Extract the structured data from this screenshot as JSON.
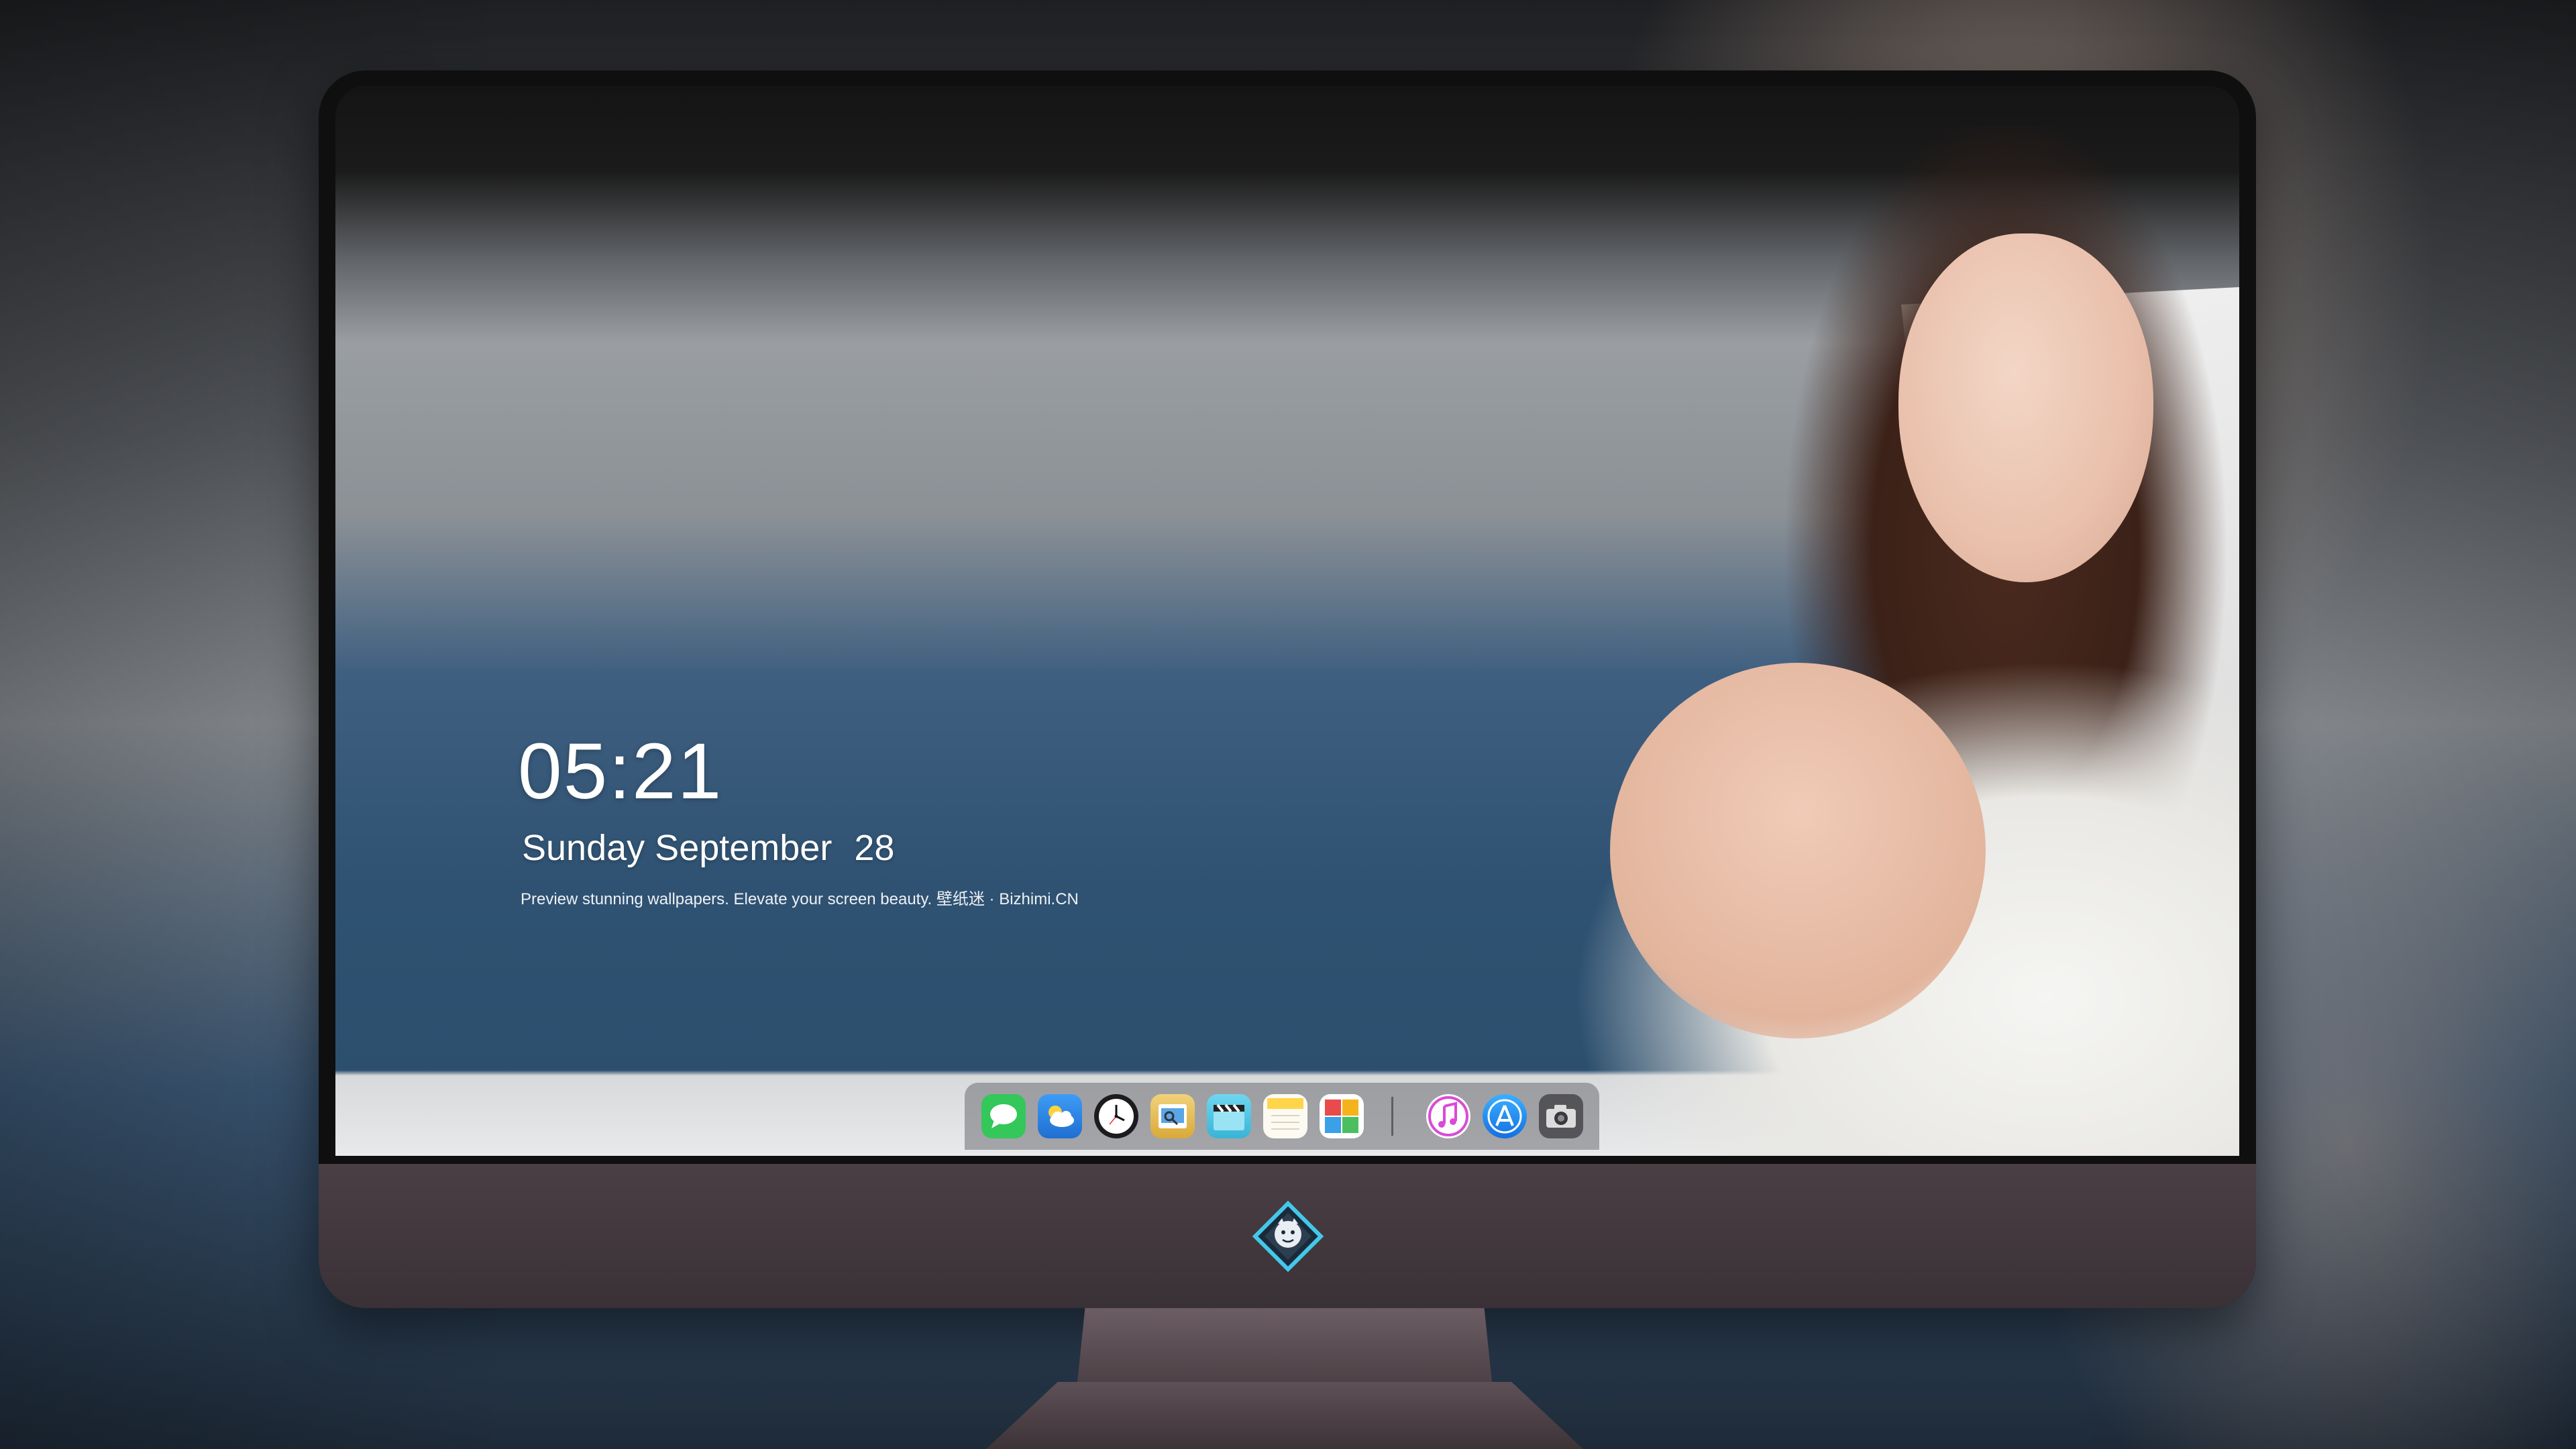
{
  "lock_screen": {
    "time": "05:21",
    "weekday": "Sunday",
    "month": "September",
    "day": "28",
    "tagline": "Preview stunning wallpapers. Elevate your screen beauty. 壁纸迷 · Bizhimi.CN"
  },
  "dock": {
    "apps": [
      {
        "name": "messages",
        "color": "#34c759"
      },
      {
        "name": "weather",
        "color": "#2f8cf0"
      },
      {
        "name": "clock",
        "color": "#1c1c1e"
      },
      {
        "name": "preview",
        "color": "#e9c25a"
      },
      {
        "name": "clips",
        "color": "#59c9e8"
      },
      {
        "name": "notes",
        "color": "#ffd54a"
      },
      {
        "name": "photo-booth",
        "color": "#ffffff"
      },
      {
        "name": "itunes",
        "color": "#d94bd6"
      },
      {
        "name": "app-store",
        "color": "#1a8cf5"
      },
      {
        "name": "camera",
        "color": "#4a4a4e"
      }
    ]
  },
  "brand": {
    "logo_icon": "dragon-diamond-icon",
    "accent": "#44c8ea"
  }
}
